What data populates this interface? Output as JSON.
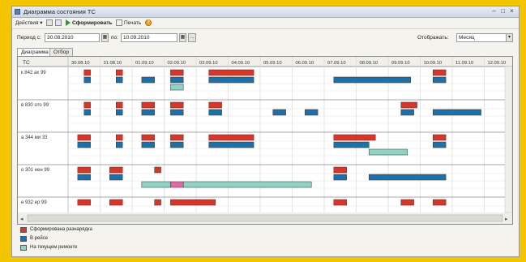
{
  "window": {
    "title": "Диаграмма состояния ТС",
    "controls": [
      "–",
      "□",
      "×"
    ]
  },
  "toolbar": {
    "actions_label": "Действия ▾",
    "generate_label": "Сформировать",
    "print_label": "Печать",
    "help_label": "?"
  },
  "filters": {
    "period_from_label": "Период с:",
    "period_from_value": "30.08.2010",
    "period_to_label": "по:",
    "period_to_value": "10.09.2010",
    "display_label": "Отображать:",
    "display_value": "Месяц"
  },
  "tabs": [
    {
      "label": "Диаграмма",
      "active": true
    },
    {
      "label": "Отбор",
      "active": false
    }
  ],
  "gantt": {
    "vehicle_header": "ТС",
    "dates": [
      "30.08.10",
      "31.08.10",
      "01.09.10",
      "02.09.10",
      "03.09.10",
      "04.09.10",
      "05.09.10",
      "06.09.10",
      "07.09.10",
      "08.09.10",
      "09.09.10",
      "10.09.10",
      "11.09.10",
      "12.09.10"
    ],
    "vehicles": [
      {
        "name": "к 842 ах 99",
        "bars": [
          {
            "status": "formed",
            "lane": 0,
            "start": 0.5,
            "end": 0.7
          },
          {
            "status": "formed",
            "lane": 0,
            "start": 1.5,
            "end": 1.7
          },
          {
            "status": "formed",
            "lane": 0,
            "start": 3.2,
            "end": 3.6
          },
          {
            "status": "formed",
            "lane": 0,
            "start": 4.4,
            "end": 5.8
          },
          {
            "status": "formed",
            "lane": 0,
            "start": 11.4,
            "end": 11.8
          },
          {
            "status": "trip",
            "lane": 1,
            "start": 0.5,
            "end": 0.7
          },
          {
            "status": "trip",
            "lane": 1,
            "start": 1.5,
            "end": 1.7
          },
          {
            "status": "trip",
            "lane": 1,
            "start": 2.3,
            "end": 2.7
          },
          {
            "status": "trip",
            "lane": 1,
            "start": 3.2,
            "end": 3.6
          },
          {
            "status": "trip",
            "lane": 1,
            "start": 4.4,
            "end": 5.8
          },
          {
            "status": "trip",
            "lane": 1,
            "start": 8.3,
            "end": 10.7
          },
          {
            "status": "trip",
            "lane": 1,
            "start": 11.4,
            "end": 11.8
          },
          {
            "status": "repair",
            "lane": 2,
            "start": 3.2,
            "end": 3.6
          }
        ]
      },
      {
        "name": "в 830 ото 99",
        "bars": [
          {
            "status": "formed",
            "lane": 0,
            "start": 0.5,
            "end": 0.7
          },
          {
            "status": "formed",
            "lane": 0,
            "start": 1.5,
            "end": 1.7
          },
          {
            "status": "formed",
            "lane": 0,
            "start": 2.3,
            "end": 2.7
          },
          {
            "status": "formed",
            "lane": 0,
            "start": 3.2,
            "end": 3.6
          },
          {
            "status": "formed",
            "lane": 0,
            "start": 4.4,
            "end": 4.8
          },
          {
            "status": "formed",
            "lane": 0,
            "start": 10.4,
            "end": 10.9
          },
          {
            "status": "trip",
            "lane": 1,
            "start": 0.5,
            "end": 0.7
          },
          {
            "status": "trip",
            "lane": 1,
            "start": 1.5,
            "end": 1.7
          },
          {
            "status": "trip",
            "lane": 1,
            "start": 2.3,
            "end": 2.7
          },
          {
            "status": "trip",
            "lane": 1,
            "start": 3.2,
            "end": 3.6
          },
          {
            "status": "trip",
            "lane": 1,
            "start": 4.4,
            "end": 4.8
          },
          {
            "status": "trip",
            "lane": 1,
            "start": 6.4,
            "end": 6.8
          },
          {
            "status": "trip",
            "lane": 1,
            "start": 7.4,
            "end": 7.8
          },
          {
            "status": "trip",
            "lane": 1,
            "start": 10.4,
            "end": 10.8
          },
          {
            "status": "trip",
            "lane": 1,
            "start": 11.4,
            "end": 12.9
          }
        ]
      },
      {
        "name": "а 344 ми 33",
        "bars": [
          {
            "status": "formed",
            "lane": 0,
            "start": 0.3,
            "end": 0.7
          },
          {
            "status": "formed",
            "lane": 0,
            "start": 1.5,
            "end": 1.7
          },
          {
            "status": "formed",
            "lane": 0,
            "start": 2.3,
            "end": 2.7
          },
          {
            "status": "formed",
            "lane": 0,
            "start": 3.2,
            "end": 3.6
          },
          {
            "status": "formed",
            "lane": 0,
            "start": 4.4,
            "end": 5.8
          },
          {
            "status": "formed",
            "lane": 0,
            "start": 8.3,
            "end": 9.6
          },
          {
            "status": "formed",
            "lane": 0,
            "start": 11.4,
            "end": 11.8
          },
          {
            "status": "trip",
            "lane": 1,
            "start": 0.3,
            "end": 0.7
          },
          {
            "status": "trip",
            "lane": 1,
            "start": 1.5,
            "end": 1.7
          },
          {
            "status": "trip",
            "lane": 1,
            "start": 2.3,
            "end": 2.7
          },
          {
            "status": "trip",
            "lane": 1,
            "start": 3.2,
            "end": 3.6
          },
          {
            "status": "trip",
            "lane": 1,
            "start": 4.4,
            "end": 5.8
          },
          {
            "status": "trip",
            "lane": 1,
            "start": 8.3,
            "end": 9.4
          },
          {
            "status": "trip",
            "lane": 1,
            "start": 11.4,
            "end": 11.8
          },
          {
            "status": "repair",
            "lane": 2,
            "start": 9.4,
            "end": 10.6
          }
        ]
      },
      {
        "name": "о 301 нен 99",
        "bars": [
          {
            "status": "formed",
            "lane": 0,
            "start": 0.3,
            "end": 0.7
          },
          {
            "status": "formed",
            "lane": 0,
            "start": 1.3,
            "end": 1.7
          },
          {
            "status": "formed",
            "lane": 0,
            "start": 2.7,
            "end": 2.9
          },
          {
            "status": "formed",
            "lane": 0,
            "start": 8.3,
            "end": 8.7
          },
          {
            "status": "trip",
            "lane": 1,
            "start": 0.3,
            "end": 0.7
          },
          {
            "status": "trip",
            "lane": 1,
            "start": 1.3,
            "end": 1.7
          },
          {
            "status": "trip",
            "lane": 1,
            "start": 8.3,
            "end": 8.7
          },
          {
            "status": "trip",
            "lane": 1,
            "start": 9.4,
            "end": 11.8
          },
          {
            "status": "repair",
            "lane": 2,
            "start": 2.3,
            "end": 3.2
          },
          {
            "status": "repair-alt",
            "lane": 2,
            "start": 3.2,
            "end": 3.6
          },
          {
            "status": "repair",
            "lane": 2,
            "start": 3.6,
            "end": 7.6
          }
        ]
      },
      {
        "name": "е 932 ер 99",
        "bars": [
          {
            "status": "formed",
            "lane": 0,
            "start": 0.3,
            "end": 0.7
          },
          {
            "status": "formed",
            "lane": 0,
            "start": 1.3,
            "end": 1.7
          },
          {
            "status": "formed",
            "lane": 0,
            "start": 2.7,
            "end": 2.9
          },
          {
            "status": "formed",
            "lane": 0,
            "start": 3.2,
            "end": 4.6
          },
          {
            "status": "formed",
            "lane": 0,
            "start": 8.3,
            "end": 8.7
          },
          {
            "status": "formed",
            "lane": 0,
            "start": 10.4,
            "end": 10.8
          },
          {
            "status": "formed",
            "lane": 0,
            "start": 11.4,
            "end": 11.8
          }
        ]
      }
    ]
  },
  "legend": [
    {
      "label": "Сформирована разнарядка",
      "color": "#d6372a"
    },
    {
      "label": "В рейсе",
      "color": "#1f6fa8"
    },
    {
      "label": "На текущем ремонте",
      "color": "#8fd3c2"
    }
  ],
  "colors": {
    "formed": "#d6372a",
    "trip": "#1f6fa8",
    "repair": "#8fd3c2",
    "repair-alt": "#e06aa6"
  }
}
